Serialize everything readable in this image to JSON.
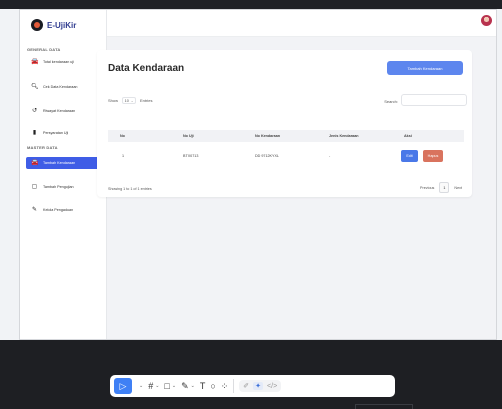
{
  "app": {
    "name": "E-UjiKir"
  },
  "colors": {
    "primary": "#3f5de6",
    "add_button": "#5d86ee",
    "edit_button": "#4a78e8",
    "delete_button": "#d9735e"
  },
  "sidebar": {
    "section_general": "GENERAL DATA",
    "general_items": [
      {
        "label": "Total kendaraan uji",
        "icon": "car-icon"
      },
      {
        "label": "Cek Data Kendaraan",
        "icon": "search-icon"
      },
      {
        "label": "Riwayat Kendaraan",
        "icon": "history-icon"
      },
      {
        "label": "Persyaratan Uji",
        "icon": "document-icon"
      }
    ],
    "section_master": "MASTER DATA",
    "master_items": [
      {
        "label": "Tambah Kendaraan",
        "icon": "car-icon",
        "active": true
      },
      {
        "label": "Tambah Pengujian",
        "icon": "clipboard-icon"
      },
      {
        "label": "Kelola Pengaduan",
        "icon": "edit-icon"
      }
    ]
  },
  "main": {
    "title": "Data Kendaraan",
    "add_button": "Tambah Kendaraan",
    "show_label": "Show",
    "entries_value": "10",
    "entries_label": "Entries",
    "search_label": "Search:",
    "search_value": "",
    "table": {
      "headers": [
        "No",
        "No Uji",
        "No Kendaraan",
        "Jenis Kendaraan",
        "Aksi"
      ],
      "rows": [
        {
          "no": "1",
          "no_uji": "BTX0713",
          "no_kendaraan": "DD 9712KYXL",
          "jenis": "-"
        }
      ],
      "edit_label": "Edit",
      "delete_label": "Hapus"
    },
    "info": "Showing 1 to 1 of 1 entries",
    "pager": {
      "previous": "Previous",
      "current": "1",
      "next": "Next"
    }
  },
  "toolbar": {
    "tools": [
      {
        "name": "move-tool",
        "glyph": "▷",
        "selected": true
      },
      {
        "name": "frame-tool",
        "glyph": "#"
      },
      {
        "name": "rectangle-tool",
        "glyph": "□"
      },
      {
        "name": "pen-tool",
        "glyph": "✎"
      },
      {
        "name": "text-tool",
        "glyph": "T"
      },
      {
        "name": "comment-tool",
        "glyph": "○"
      },
      {
        "name": "actions-tool",
        "glyph": "⁘"
      }
    ],
    "modes": [
      {
        "name": "draw-mode",
        "glyph": "✐"
      },
      {
        "name": "design-mode",
        "glyph": "✦",
        "on": true
      },
      {
        "name": "dev-mode",
        "glyph": "</>"
      }
    ]
  }
}
